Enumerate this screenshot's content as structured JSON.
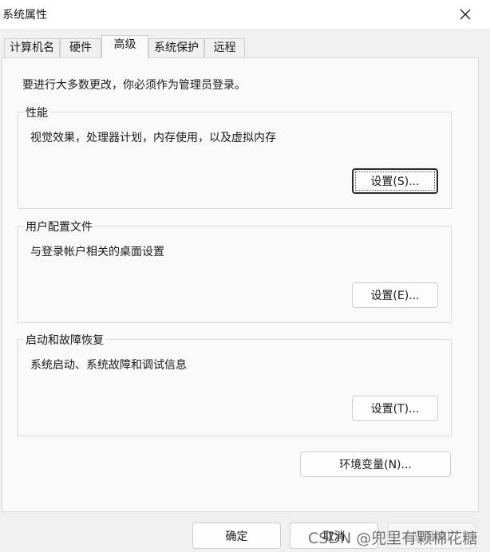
{
  "window": {
    "title": "系统属性"
  },
  "tabs": [
    {
      "label": "计算机名"
    },
    {
      "label": "硬件"
    },
    {
      "label": "高级"
    },
    {
      "label": "系统保护"
    },
    {
      "label": "远程"
    }
  ],
  "admin_note": "要进行大多数更改，你必须作为管理员登录。",
  "performance": {
    "title": "性能",
    "description": "视觉效果，处理器计划，内存使用，以及虚拟内存",
    "button": "设置(S)..."
  },
  "user_profiles": {
    "title": "用户配置文件",
    "description": "与登录帐户相关的桌面设置",
    "button": "设置(E)..."
  },
  "startup_recovery": {
    "title": "启动和故障恢复",
    "description": "系统启动、系统故障和调试信息",
    "button": "设置(T)..."
  },
  "env_button": "环境变量(N)...",
  "footer": {
    "ok": "确定",
    "cancel": "取消",
    "apply": "应用(A)"
  },
  "watermark": "CSDN @兜里有颗棉花糖",
  "icons": {
    "close": "close-icon"
  }
}
